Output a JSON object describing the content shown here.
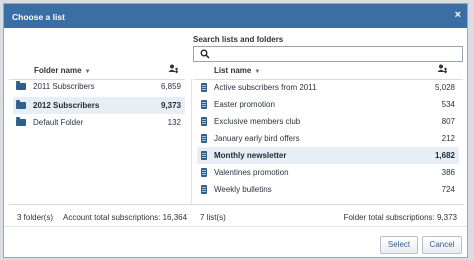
{
  "dialog": {
    "title": "Choose a list",
    "close": "×"
  },
  "search": {
    "label": "Search lists and folders",
    "placeholder": ""
  },
  "folders": {
    "header": "Folder name",
    "items": [
      {
        "label": "2011 Subscribers",
        "count": "6,859",
        "selected": false
      },
      {
        "label": "2012 Subscribers",
        "count": "9,373",
        "selected": true
      },
      {
        "label": "Default Folder",
        "count": "132",
        "selected": false
      }
    ],
    "footer_count": "3 folder(s)",
    "footer_total": "Account total subscriptions: 16,364"
  },
  "lists": {
    "header": "List name",
    "items": [
      {
        "label": "Active subscribers from 2011",
        "count": "5,028",
        "selected": false
      },
      {
        "label": "Easter promotion",
        "count": "534",
        "selected": false
      },
      {
        "label": "Exclusive members club",
        "count": "807",
        "selected": false
      },
      {
        "label": "January early bird offers",
        "count": "212",
        "selected": false
      },
      {
        "label": "Monthly newsletter",
        "count": "1,682",
        "selected": true
      },
      {
        "label": "Valentines promotion",
        "count": "386",
        "selected": false
      },
      {
        "label": "Weekly bulletins",
        "count": "724",
        "selected": false
      }
    ],
    "footer_count": "7 list(s)",
    "footer_total": "Folder total subscriptions: 9,373"
  },
  "buttons": {
    "select": "Select",
    "cancel": "Cancel"
  },
  "colors": {
    "titlebar": "#3b6ea5",
    "selected_row": "#e8eef6",
    "icon": "#2f5f8e"
  }
}
